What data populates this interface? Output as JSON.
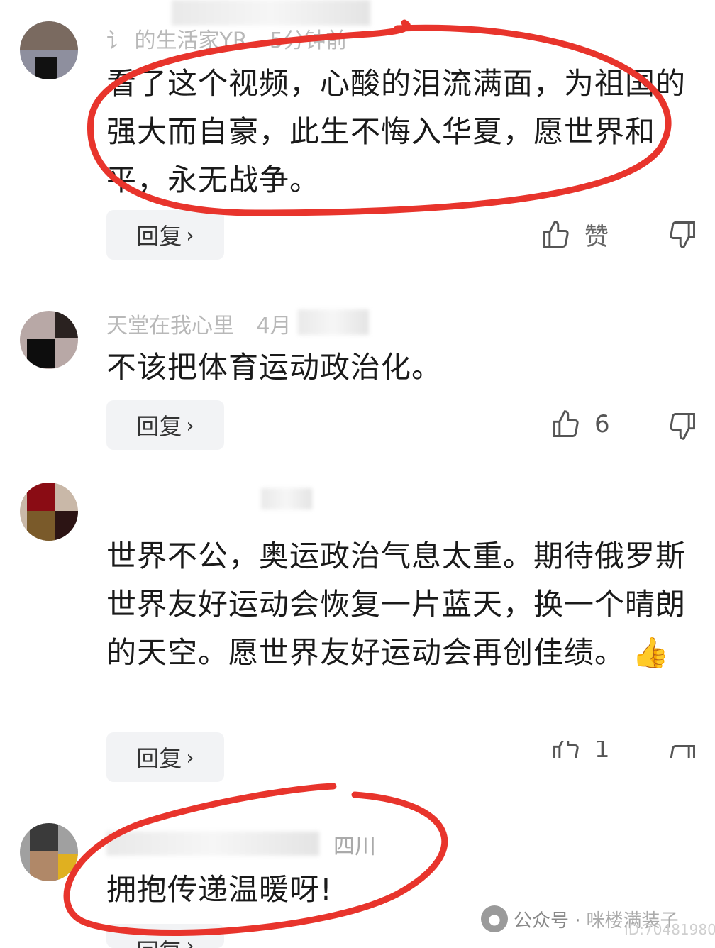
{
  "comments": [
    {
      "username": "讠 的生活家YR",
      "time": "5分钟前",
      "text": "看了这个视频，心酸的泪流满面，为祖国的强大而自豪，此生不悔入华夏，愿世界和平，永无战争。",
      "reply_label": "回复",
      "like_label": "赞"
    },
    {
      "username": "天堂在我心里",
      "time": "4月",
      "text": "不该把体育运动政治化。",
      "reply_label": "回复",
      "like_count": "6"
    },
    {
      "username": "",
      "time": "",
      "text": "世界不公，奥运政治气息太重。期待俄罗斯世界友好运动会恢复一片蓝天，换一个晴朗的天空。愿世界友好运动会再创佳绩。",
      "emoji": "👍",
      "reply_label": "回复",
      "like_count": "1"
    },
    {
      "username": "",
      "location": "四川",
      "text": "拥抱传递温暖呀!",
      "reply_label": "回复"
    }
  ],
  "watermark": {
    "label": "公众号 · ",
    "name": "咪楼满装子",
    "id": "ID:70481980"
  },
  "colors": {
    "annotation_red": "#e8342c",
    "reply_bg": "#f2f3f5"
  }
}
